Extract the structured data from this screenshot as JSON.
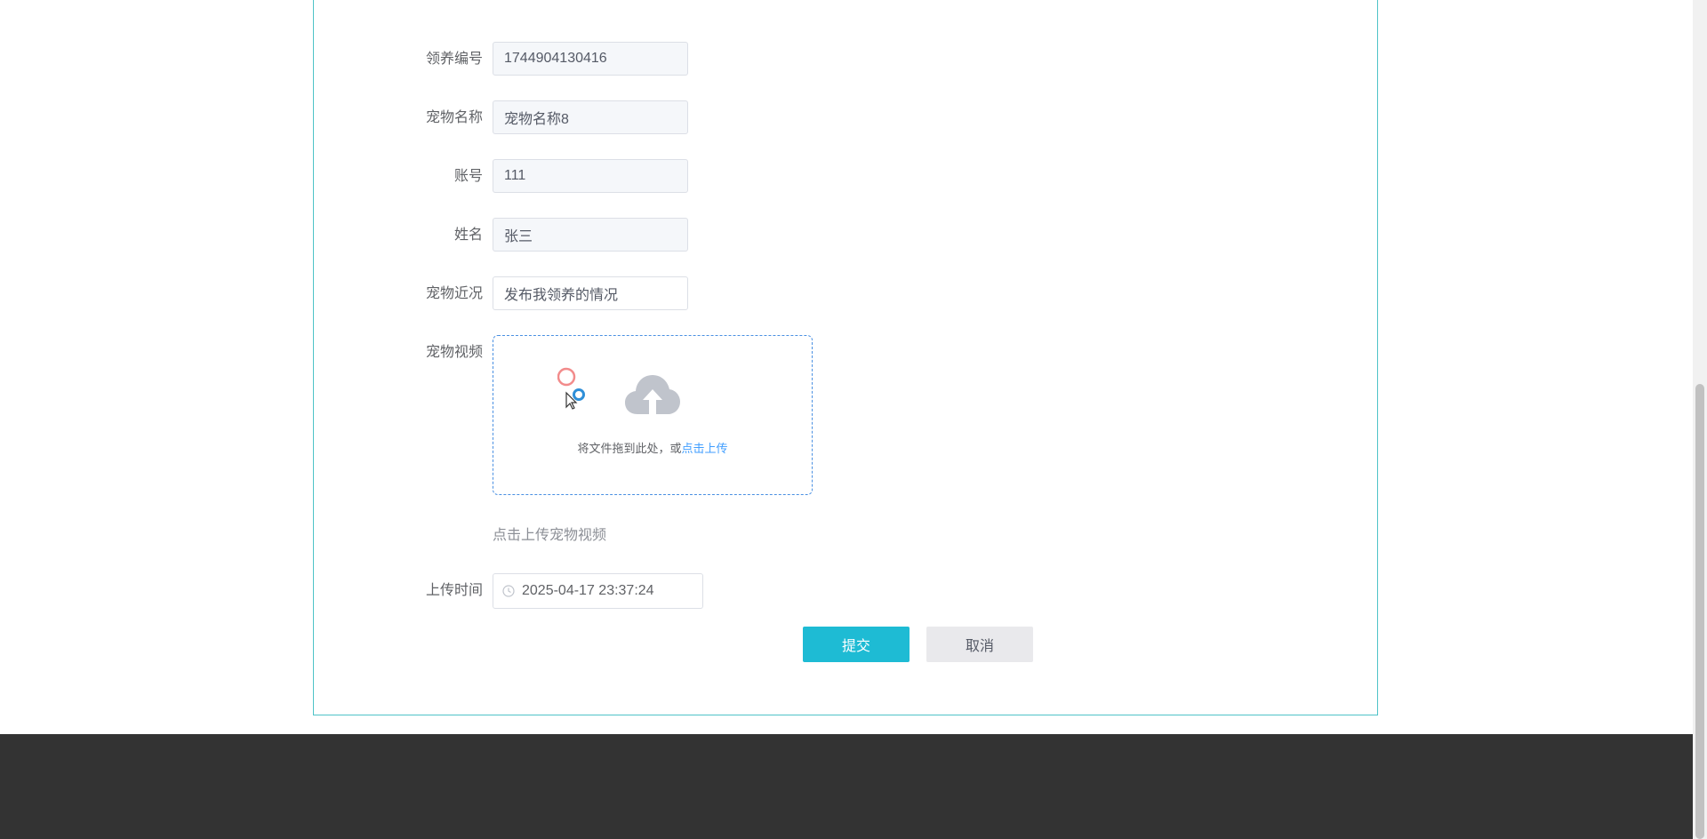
{
  "form": {
    "fields": [
      {
        "label": "领养编号",
        "value": "1744904130416"
      },
      {
        "label": "宠物名称",
        "value": "宠物名称8"
      },
      {
        "label": "账号",
        "value": "111"
      },
      {
        "label": "姓名",
        "value": "张三"
      },
      {
        "label": "宠物近况",
        "value": "发布我领养的情况"
      }
    ],
    "video": {
      "label": "宠物视频",
      "upload_text": "将文件拖到此处，或",
      "upload_link": "点击上传",
      "tip": "点击上传宠物视频"
    },
    "upload_time": {
      "label": "上传时间",
      "value": "2025-04-17 23:37:24"
    },
    "buttons": {
      "submit": "提交",
      "cancel": "取消"
    }
  },
  "colors": {
    "accent": "#1ebbd4",
    "panel_border": "#4fc3c8",
    "footer": "#333333",
    "link": "#409eff"
  }
}
